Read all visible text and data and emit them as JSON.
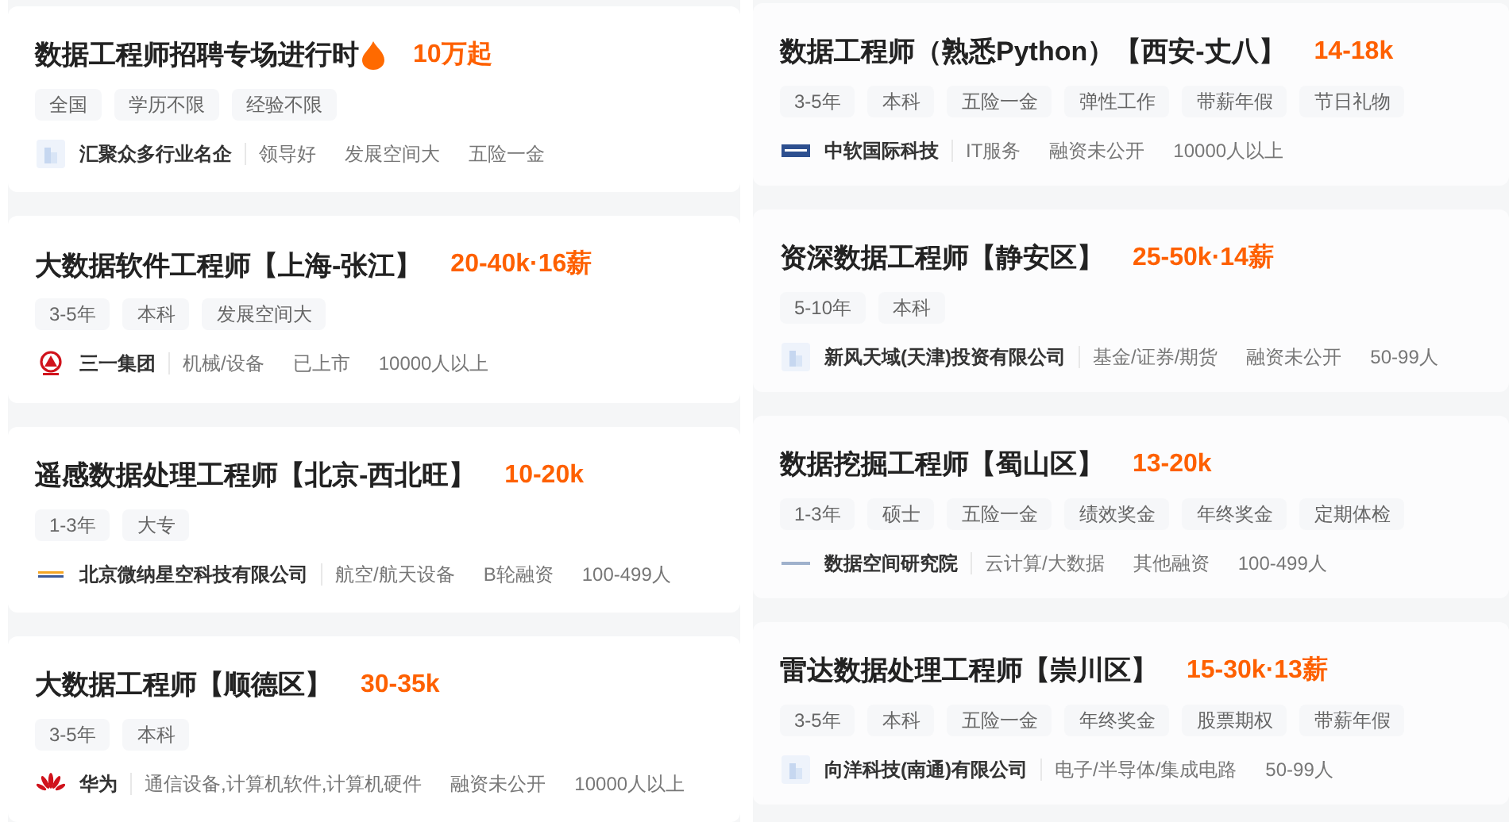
{
  "columns": [
    {
      "jobs": [
        {
          "title": "数据工程师招聘专场进行时",
          "hot": true,
          "salary": "10万起",
          "tags": [
            "全国",
            "学历不限",
            "经验不限"
          ],
          "company": "汇聚众多行业名企",
          "info": [
            "领导好",
            "发展空间大",
            "五险一金"
          ]
        },
        {
          "title": "大数据软件工程师【上海-张江】",
          "hot": false,
          "salary": "20-40k·16薪",
          "tags": [
            "3-5年",
            "本科",
            "发展空间大"
          ],
          "company": "三一集团",
          "info": [
            "机械/设备",
            "已上市",
            "10000人以上"
          ]
        },
        {
          "title": "遥感数据处理工程师【北京-西北旺】",
          "hot": false,
          "salary": "10-20k",
          "tags": [
            "1-3年",
            "大专"
          ],
          "company": "北京微纳星空科技有限公司",
          "info": [
            "航空/航天设备",
            "B轮融资",
            "100-499人"
          ]
        },
        {
          "title": "大数据工程师【顺德区】",
          "hot": false,
          "salary": "30-35k",
          "tags": [
            "3-5年",
            "本科"
          ],
          "company": "华为",
          "info": [
            "通信设备,计算机软件,计算机硬件",
            "融资未公开",
            "10000人以上"
          ]
        }
      ]
    },
    {
      "jobs": [
        {
          "title": "数据工程师（熟悉Python）【西安-丈八】",
          "hot": false,
          "salary": "14-18k",
          "tags": [
            "3-5年",
            "本科",
            "五险一金",
            "弹性工作",
            "带薪年假",
            "节日礼物"
          ],
          "company": "中软国际科技",
          "info": [
            "IT服务",
            "融资未公开",
            "10000人以上"
          ]
        },
        {
          "title": "资深数据工程师【静安区】",
          "hot": false,
          "salary": "25-50k·14薪",
          "tags": [
            "5-10年",
            "本科"
          ],
          "company": "新风天域(天津)投资有限公司",
          "info": [
            "基金/证券/期货",
            "融资未公开",
            "50-99人"
          ]
        },
        {
          "title": "数据挖掘工程师【蜀山区】",
          "hot": false,
          "salary": "13-20k",
          "tags": [
            "1-3年",
            "硕士",
            "五险一金",
            "绩效奖金",
            "年终奖金",
            "定期体检"
          ],
          "company": "数据空间研究院",
          "info": [
            "云计算/大数据",
            "其他融资",
            "100-499人"
          ]
        },
        {
          "title": "雷达数据处理工程师【崇川区】",
          "hot": false,
          "salary": "15-30k·13薪",
          "tags": [
            "3-5年",
            "本科",
            "五险一金",
            "年终奖金",
            "股票期权",
            "带薪年假"
          ],
          "company": "向洋科技(南通)有限公司",
          "info": [
            "电子/半导体/集成电路",
            "50-99人"
          ]
        }
      ]
    }
  ]
}
